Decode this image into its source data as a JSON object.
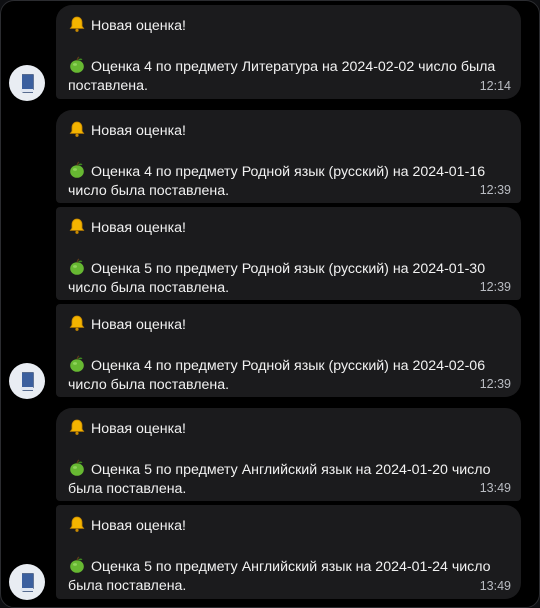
{
  "messages": [
    {
      "title": "Новая оценка!",
      "body": "Оценка 4 по предмету Литература на 2024-02-02 число была поставлена.",
      "time": "12:14"
    },
    {
      "title": "Новая оценка!",
      "body": "Оценка 4 по предмету Родной язык (русский) на 2024-01-16 число была поставлена.",
      "time": "12:39"
    },
    {
      "title": "Новая оценка!",
      "body": "Оценка 5 по предмету Родной язык (русский) на 2024-01-30 число была поставлена.",
      "time": "12:39"
    },
    {
      "title": "Новая оценка!",
      "body": "Оценка 4 по предмету Родной язык (русский) на 2024-02-06 число была поставлена.",
      "time": "12:39"
    },
    {
      "title": "Новая оценка!",
      "body": "Оценка 5 по предмету Английский язык на 2024-01-20 число была поставлена.",
      "time": "13:49"
    },
    {
      "title": "Новая оценка!",
      "body": "Оценка 5 по предмету Английский язык на 2024-01-24 число была поставлена.",
      "time": "13:49"
    }
  ],
  "icons": {
    "title_icon": "bell-icon",
    "body_icon": "green-apple-icon",
    "avatar_icon": "book-icon"
  },
  "colors": {
    "background": "#000000",
    "bubble": "#1b1b1d",
    "text": "#f2f2f2",
    "time": "#b9bcc2",
    "avatar": "#e9edf3",
    "book": "#3b5f9e"
  }
}
